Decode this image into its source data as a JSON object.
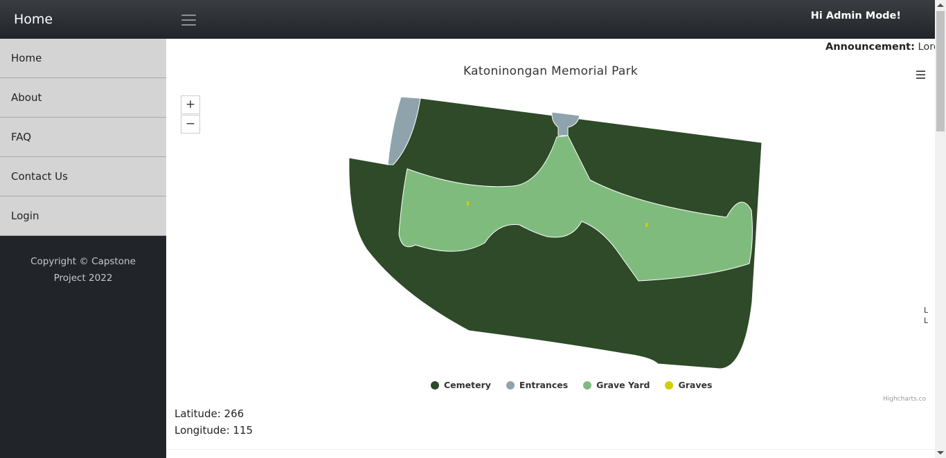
{
  "sidebar": {
    "brand": "Home",
    "items": [
      {
        "label": "Home"
      },
      {
        "label": "About"
      },
      {
        "label": "FAQ"
      },
      {
        "label": "Contact Us"
      },
      {
        "label": "Login"
      }
    ],
    "copyright": "Copyright © Capstone Project 2022"
  },
  "header": {
    "greeting": "Hi Admin Mode!"
  },
  "announcement": {
    "label": "Announcement:",
    "text": "Lorem"
  },
  "map": {
    "title": "Katoninongan Memorial Park",
    "zoom_in": "+",
    "zoom_out": "−",
    "credits": "Highcharts.com",
    "clipped_text_1": "L",
    "clipped_text_2": "L",
    "legend": [
      {
        "name": "Cemetery",
        "color": "#2e4a29"
      },
      {
        "name": "Entrances",
        "color": "#8fa3ac"
      },
      {
        "name": "Grave Yard",
        "color": "#80bb7e"
      },
      {
        "name": "Graves",
        "color": "#cfcf00"
      }
    ]
  },
  "coordinates": {
    "latitude": "Latitude: 266",
    "longitude": "Longitude: 115"
  },
  "icons": {
    "menu": "hamburger-icon",
    "export": "chart-menu-icon"
  }
}
